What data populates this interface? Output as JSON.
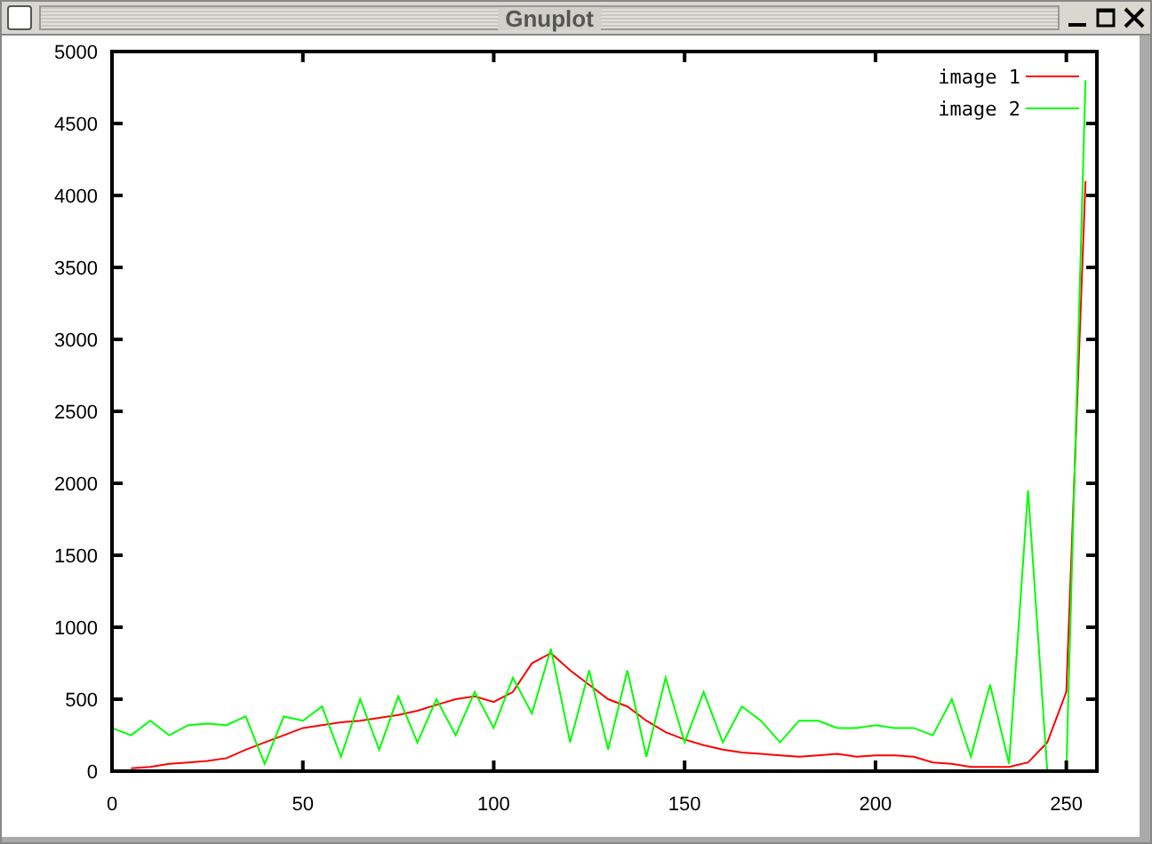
{
  "window": {
    "title": "Gnuplot"
  },
  "plot": {
    "chart_data": {
      "type": "line",
      "x": [
        0,
        5,
        10,
        15,
        20,
        25,
        30,
        35,
        40,
        45,
        50,
        55,
        60,
        65,
        70,
        75,
        80,
        85,
        90,
        95,
        100,
        105,
        110,
        115,
        120,
        125,
        130,
        135,
        140,
        145,
        150,
        155,
        160,
        165,
        170,
        175,
        180,
        185,
        190,
        195,
        200,
        205,
        210,
        215,
        220,
        225,
        230,
        235,
        240,
        245,
        250,
        255
      ],
      "series": [
        {
          "name": "image 1",
          "color": "#ff0000",
          "values": [
            null,
            20,
            30,
            50,
            60,
            70,
            90,
            150,
            200,
            250,
            300,
            320,
            340,
            350,
            370,
            390,
            420,
            460,
            500,
            520,
            480,
            550,
            750,
            820,
            700,
            600,
            500,
            450,
            350,
            270,
            220,
            180,
            150,
            130,
            120,
            110,
            100,
            110,
            120,
            100,
            110,
            110,
            100,
            60,
            50,
            30,
            30,
            30,
            60,
            200,
            550,
            4100
          ]
        },
        {
          "name": "image 2",
          "color": "#00ff00",
          "values": [
            300,
            250,
            350,
            250,
            320,
            330,
            320,
            380,
            50,
            380,
            350,
            450,
            100,
            500,
            150,
            520,
            200,
            500,
            250,
            550,
            300,
            650,
            400,
            850,
            200,
            700,
            150,
            700,
            100,
            650,
            200,
            550,
            200,
            450,
            350,
            200,
            350,
            350,
            300,
            300,
            320,
            300,
            300,
            250,
            500,
            100,
            600,
            50,
            1950,
            0,
            0,
            4800
          ]
        }
      ],
      "legend": "upper right",
      "xlim": [
        0,
        258
      ],
      "ylim": [
        0,
        5000
      ],
      "xticks": [
        0,
        50,
        100,
        150,
        200,
        250
      ],
      "yticks": [
        0,
        500,
        1000,
        1500,
        2000,
        2500,
        3000,
        3500,
        4000,
        4500,
        5000
      ]
    }
  }
}
